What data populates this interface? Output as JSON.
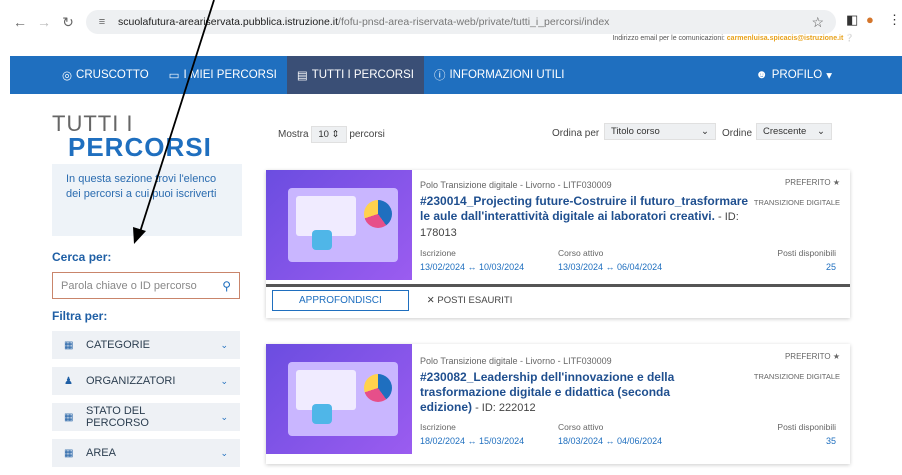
{
  "browser": {
    "url_host": "scuolafutura-areariservata.pubblica.istruzione.it",
    "url_path": "/fofu-pnsd-area-riservata-web/private/tutti_i_percorsi/index"
  },
  "notice": {
    "text": "Indirizzo email per le comunicazioni:",
    "email": "carmenluisa.spicacis@istruzione.it"
  },
  "nav": {
    "items": [
      "CRUSCOTTO",
      "I MIEI PERCORSI",
      "TUTTI I PERCORSI",
      "INFORMAZIONI UTILI"
    ],
    "profile": "PROFILO"
  },
  "sidebar": {
    "title_line1": "TUTTI I",
    "title_line2": "PERCORSI",
    "intro": "In questa sezione trovi l'elenco dei percorsi a cui puoi iscriverti",
    "search_label": "Cerca per:",
    "search_placeholder": "Parola chiave o ID percorso",
    "filter_label": "Filtra per:",
    "filters": [
      "CATEGORIE",
      "ORGANIZZATORI",
      "STATO DEL PERCORSO",
      "AREA"
    ]
  },
  "toolbar": {
    "show_label": "Mostra",
    "show_value": "10",
    "show_suffix": "percorsi",
    "order_by_label": "Ordina per",
    "order_by_value": "Titolo corso",
    "order_label": "Ordine",
    "order_value": "Crescente"
  },
  "cards": [
    {
      "org": "Polo Transizione digitale - Livorno - LITF030009",
      "favorite": "PREFERITO",
      "category": "TRANSIZIONE DIGITALE",
      "title": "#230014_Projecting future-Costruire il futuro_trasformare le aule dall'interattività digitale ai laboratori creativi.",
      "id": " - ID: 178013",
      "enroll_label": "Iscrizione",
      "enroll_dates": "13/02/2024 ↔ 10/03/2024",
      "course_label": "Corso attivo",
      "course_dates": "13/03/2024 ↔ 06/04/2024",
      "seats_label": "Posti disponibili",
      "seats": "25",
      "button": "APPROFONDISCI",
      "status": "POSTI ESAURITI"
    },
    {
      "org": "Polo Transizione digitale - Livorno - LITF030009",
      "favorite": "PREFERITO",
      "category": "TRANSIZIONE DIGITALE",
      "title": "#230082_Leadership dell'innovazione e della trasformazione digitale e didattica (seconda edizione)",
      "id": " - ID: 222012",
      "enroll_label": "Iscrizione",
      "enroll_dates": "18/02/2024 ↔ 15/03/2024",
      "course_label": "Corso attivo",
      "course_dates": "18/03/2024 ↔ 04/06/2024",
      "seats_label": "Posti disponibili",
      "seats": "35"
    }
  ]
}
